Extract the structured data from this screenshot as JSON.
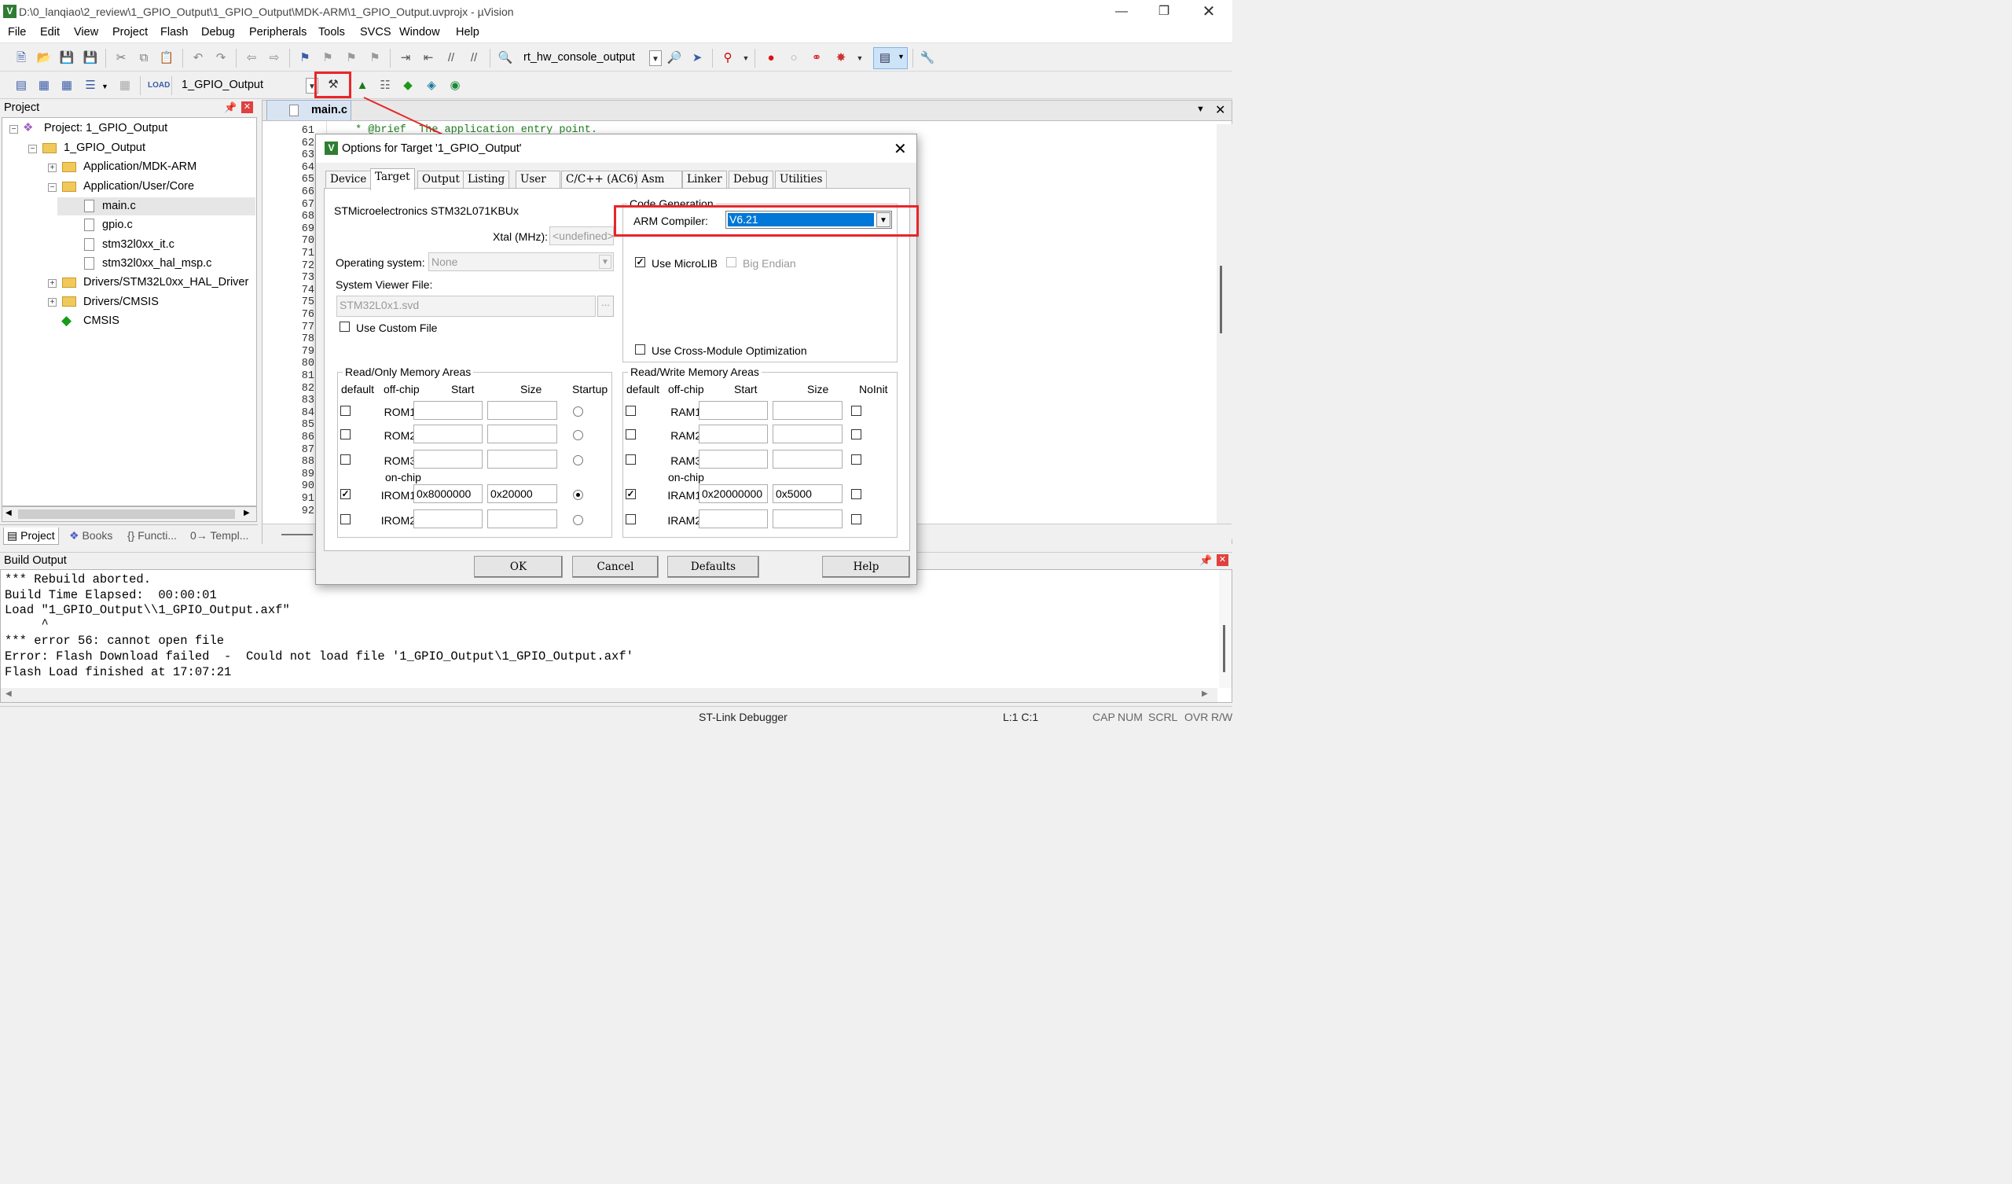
{
  "window": {
    "title": "D:\\0_lanqiao\\2_review\\1_GPIO_Output\\1_GPIO_Output\\MDK-ARM\\1_GPIO_Output.uvprojx - µVision"
  },
  "menu": [
    "File",
    "Edit",
    "View",
    "Project",
    "Flash",
    "Debug",
    "Peripherals",
    "Tools",
    "SVCS",
    "Window",
    "Help"
  ],
  "toolbar": {
    "find_combo": "rt_hw_console_output",
    "target_combo": "1_GPIO_Output"
  },
  "project_panel": {
    "title": "Project",
    "tree": [
      {
        "label": "Project: 1_GPIO_Output"
      },
      {
        "label": "1_GPIO_Output"
      },
      {
        "label": "Application/MDK-ARM"
      },
      {
        "label": "Application/User/Core"
      },
      {
        "label": "main.c"
      },
      {
        "label": "gpio.c"
      },
      {
        "label": "stm32l0xx_it.c"
      },
      {
        "label": "stm32l0xx_hal_msp.c"
      },
      {
        "label": "Drivers/STM32L0xx_HAL_Driver"
      },
      {
        "label": "Drivers/CMSIS"
      },
      {
        "label": "CMSIS"
      }
    ],
    "tabs": [
      "Project",
      "Books",
      "{} Functi...",
      "0→ Templ..."
    ]
  },
  "editor": {
    "tab": "main.c",
    "first_line": " * @brief  The application entry point.",
    "line_numbers": [
      "61",
      "62",
      "63",
      "64",
      "65",
      "66",
      "67",
      "68",
      "69",
      "70",
      "71",
      "72",
      "73",
      "74",
      "75",
      "76",
      "77",
      "78",
      "79",
      "80",
      "81",
      "82",
      "83",
      "84",
      "85",
      "86",
      "87",
      "88",
      "89",
      "90",
      "91",
      "92"
    ]
  },
  "build_output": {
    "title": "Build Output",
    "lines": [
      "*** Rebuild aborted.",
      "Build Time Elapsed:  00:00:01",
      "Load \"1_GPIO_Output\\\\1_GPIO_Output.axf\"",
      "     ^",
      "*** error 56: cannot open file",
      "Error: Flash Download failed  -  Could not load file '1_GPIO_Output\\1_GPIO_Output.axf'",
      "Flash Load finished at 17:07:21"
    ]
  },
  "statusbar": {
    "debugger": "ST-Link Debugger",
    "position": "L:1 C:1",
    "indicators": [
      "CAP",
      "NUM",
      "SCRL",
      "OVR",
      "R/W"
    ]
  },
  "dialog": {
    "title": "Options for Target '1_GPIO_Output'",
    "tabs": [
      "Device",
      "Target",
      "Output",
      "Listing",
      "User",
      "C/C++ (AC6)",
      "Asm",
      "Linker",
      "Debug",
      "Utilities"
    ],
    "active_tab": "Target",
    "device": "STMicroelectronics STM32L071KBUx",
    "xtal_label": "Xtal (MHz):",
    "xtal_value": "<undefined>",
    "os_label": "Operating system:",
    "os_value": "None",
    "svf_label": "System Viewer File:",
    "svf_value": "STM32L0x1.svd",
    "browse": "...",
    "use_custom_file": "Use Custom File",
    "codegen_title": "Code Generation",
    "compiler_label": "ARM Compiler:",
    "compiler_value": "V6.21",
    "use_microlib": "Use MicroLIB",
    "big_endian": "Big Endian",
    "cross_module": "Use Cross-Module Optimization",
    "ro": {
      "title": "Read/Only Memory Areas",
      "headers": [
        "default",
        "off-chip",
        "Start",
        "Size",
        "Startup"
      ],
      "onchip": "on-chip",
      "rows": [
        {
          "name": "ROM1:",
          "start": "",
          "size": "",
          "def": false,
          "sel": false
        },
        {
          "name": "ROM2:",
          "start": "",
          "size": "",
          "def": false,
          "sel": false
        },
        {
          "name": "ROM3:",
          "start": "",
          "size": "",
          "def": false,
          "sel": false
        },
        {
          "name": "IROM1:",
          "start": "0x8000000",
          "size": "0x20000",
          "def": true,
          "sel": true
        },
        {
          "name": "IROM2:",
          "start": "",
          "size": "",
          "def": false,
          "sel": false
        }
      ]
    },
    "rw": {
      "title": "Read/Write Memory Areas",
      "headers": [
        "default",
        "off-chip",
        "Start",
        "Size",
        "NoInit"
      ],
      "onchip": "on-chip",
      "rows": [
        {
          "name": "RAM1:",
          "start": "",
          "size": "",
          "def": false
        },
        {
          "name": "RAM2:",
          "start": "",
          "size": "",
          "def": false
        },
        {
          "name": "RAM3:",
          "start": "",
          "size": "",
          "def": false
        },
        {
          "name": "IRAM1:",
          "start": "0x20000000",
          "size": "0x5000",
          "def": true
        },
        {
          "name": "IRAM2:",
          "start": "",
          "size": "",
          "def": false
        }
      ]
    },
    "buttons": {
      "ok": "OK",
      "cancel": "Cancel",
      "defaults": "Defaults",
      "help": "Help"
    }
  },
  "colors": {
    "highlight": "#0078d7",
    "annotation": "#e8262a"
  }
}
